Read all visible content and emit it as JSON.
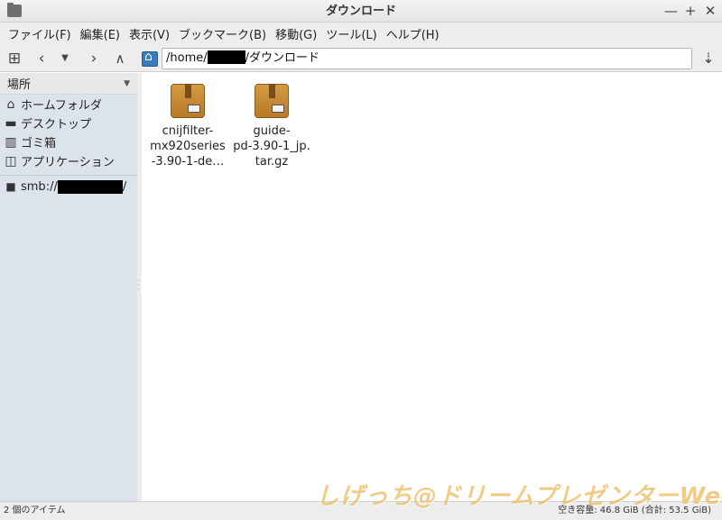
{
  "window": {
    "title": "ダウンロード",
    "controls": [
      "—",
      "+",
      "✕"
    ]
  },
  "menu": [
    "ファイル(F)",
    "編集(E)",
    "表示(V)",
    "ブックマーク(B)",
    "移動(G)",
    "ツール(L)",
    "ヘルプ(H)"
  ],
  "toolbar": {
    "new_tab_icon": "new-tab-icon",
    "back_icon": "back-icon",
    "history_icon": "history-dropdown-icon",
    "forward_icon": "forward-icon",
    "up_icon": "up-icon",
    "home_icon": "home-folder-icon",
    "path_prefix": "/home/",
    "path_suffix": "/ダウンロード",
    "go_icon": "go-icon"
  },
  "sidebar": {
    "header": "場所",
    "items": [
      {
        "label": "ホームフォルダ",
        "icon": "home-icon"
      },
      {
        "label": "デスクトップ",
        "icon": "desktop-icon"
      },
      {
        "label": "ゴミ箱",
        "icon": "trash-icon"
      },
      {
        "label": "アプリケーション",
        "icon": "applications-icon"
      }
    ],
    "network": {
      "prefix": "smb://",
      "suffix": "/",
      "icon": "network-folder-icon"
    }
  },
  "files": [
    {
      "name": "cnijfilter-mx920series-3.90-1-de…",
      "lines": [
        "cnijfilter-",
        "mx920series",
        "-3.90-1-de…"
      ],
      "icon": "package-icon"
    },
    {
      "name": "guide-pd-3.90-1_jp.tar.gz",
      "lines": [
        "guide-",
        "pd-3.90-1_jp.",
        "tar.gz"
      ],
      "icon": "package-icon"
    }
  ],
  "status": {
    "item_count": "2 個のアイテム",
    "free_space": "空き容量: 46.8 GiB (合計: 53.5 GiB)"
  },
  "watermark": "しげっち@ドリームプレゼンターWeb",
  "colors": {
    "selection": "#dde3ea",
    "package": "#c58a35",
    "watermark": "#e8ac3c"
  }
}
